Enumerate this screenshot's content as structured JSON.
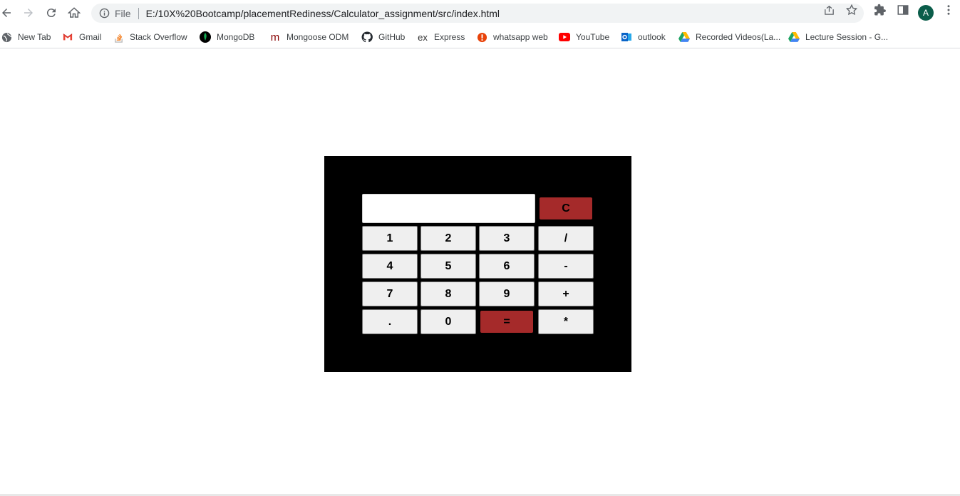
{
  "browser": {
    "omnibox_scheme": "File",
    "url": "E:/10X%20Bootcamp/placementRediness/Calculator_assignment/src/index.html",
    "profile_initial": "A"
  },
  "bookmarks": [
    {
      "label": "New Tab",
      "icon": "globe-icon",
      "color": "#5f6368"
    },
    {
      "label": "Gmail",
      "icon": "gmail-icon",
      "color": "#ea4335"
    },
    {
      "label": "Stack Overflow",
      "icon": "stackoverflow-icon",
      "color": "#f48024"
    },
    {
      "label": "MongoDB",
      "icon": "mongodb-icon",
      "color": "#13aa52"
    },
    {
      "label": "Mongoose ODM",
      "icon": "mongoose-icon",
      "color": "#880000"
    },
    {
      "label": "GitHub",
      "icon": "github-icon",
      "color": "#24292f"
    },
    {
      "label": "Express",
      "icon": "express-icon",
      "color": "#333333"
    },
    {
      "label": "whatsapp web",
      "icon": "alert-icon",
      "color": "#e8430a"
    },
    {
      "label": "YouTube",
      "icon": "youtube-icon",
      "color": "#ff0000"
    },
    {
      "label": "outlook",
      "icon": "outlook-icon",
      "color": "#0a64c8"
    },
    {
      "label": "Recorded Videos(La...",
      "icon": "drive-icon",
      "color": "#1fa463"
    },
    {
      "label": "Lecture Session - G...",
      "icon": "drive-icon",
      "color": "#1fa463"
    }
  ],
  "calculator": {
    "display_value": "",
    "clear_label": "C",
    "keys": [
      "1",
      "2",
      "3",
      "/",
      "4",
      "5",
      "6",
      "-",
      "7",
      "8",
      "9",
      "+",
      ".",
      "0",
      "=",
      "*"
    ],
    "accent_color": "#a52a2a"
  }
}
